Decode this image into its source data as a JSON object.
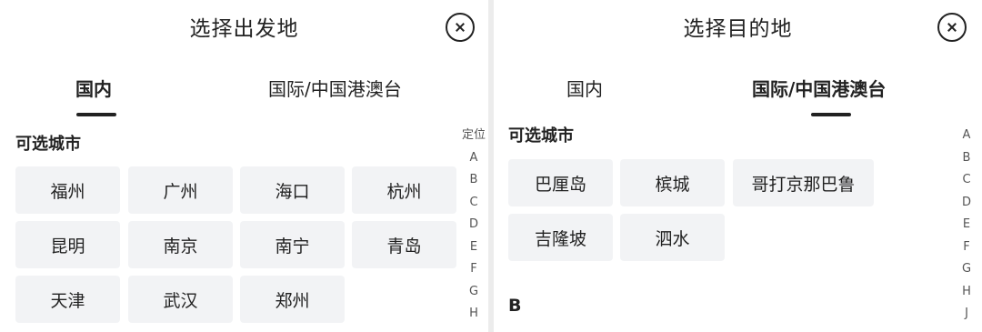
{
  "left": {
    "title": "选择出发地",
    "tabs": [
      {
        "label": "国内",
        "active": true
      },
      {
        "label": "国际/中国港澳台",
        "active": false
      }
    ],
    "section_label": "可选城市",
    "cities": [
      "福州",
      "广州",
      "海口",
      "杭州",
      "昆明",
      "南京",
      "南宁",
      "青岛",
      "天津",
      "武汉",
      "郑州"
    ],
    "index_bar": [
      "定位",
      "A",
      "B",
      "C",
      "D",
      "E",
      "F",
      "G",
      "H"
    ]
  },
  "right": {
    "title": "选择目的地",
    "tabs": [
      {
        "label": "国内",
        "active": false
      },
      {
        "label": "国际/中国港澳台",
        "active": true
      }
    ],
    "section_label": "可选城市",
    "cities": [
      "巴厘岛",
      "槟城",
      "哥打京那巴鲁",
      "吉隆坡",
      "泗水"
    ],
    "group_header": "B",
    "index_bar": [
      "A",
      "B",
      "C",
      "D",
      "E",
      "F",
      "G",
      "H",
      "J"
    ]
  },
  "icons": {
    "close": "close-circle-icon"
  }
}
